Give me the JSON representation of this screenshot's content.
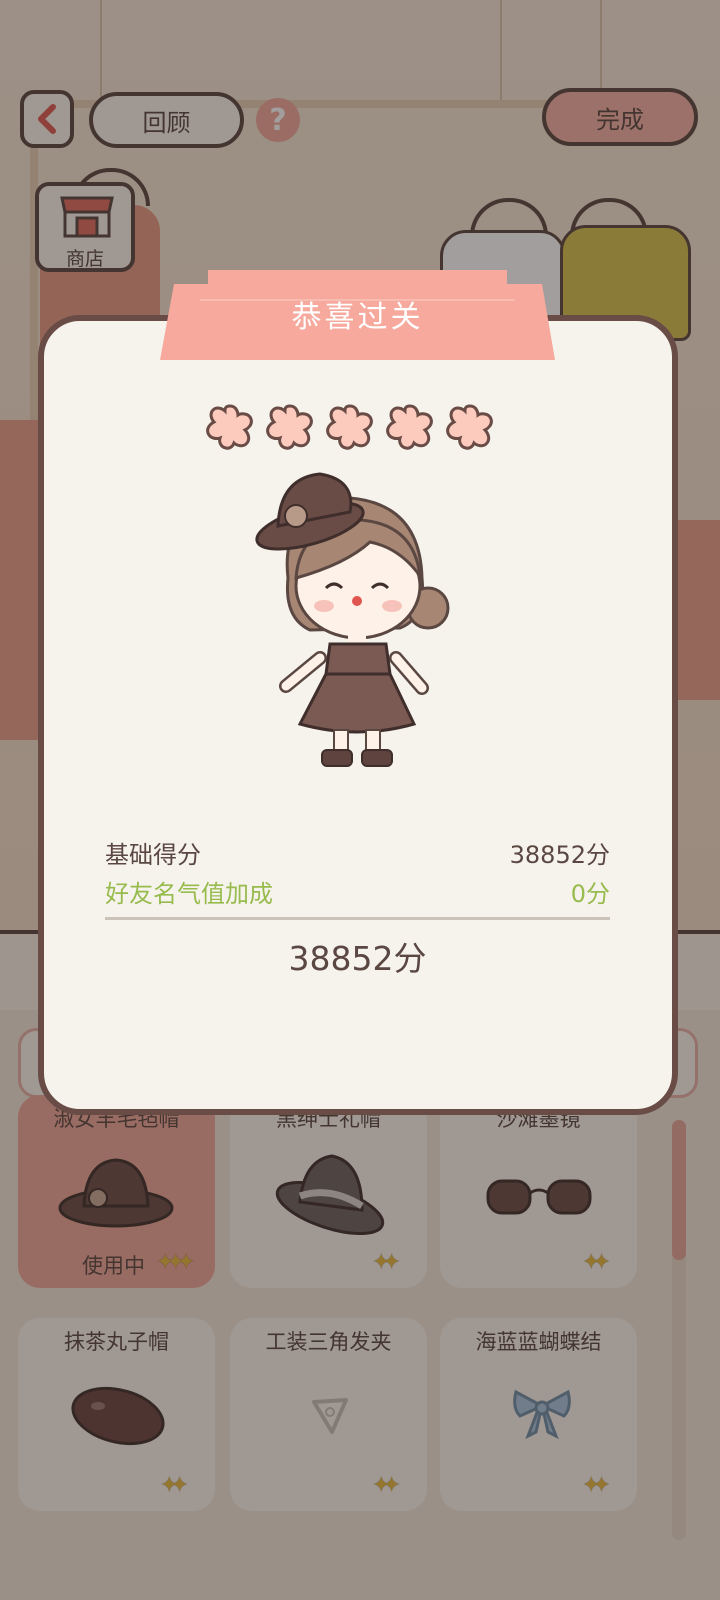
{
  "header": {
    "back_icon": "chevron-left-icon",
    "review_label": "回顾",
    "help_icon": "question-mark-icon",
    "done_label": "完成"
  },
  "shop": {
    "label": "商店",
    "icon": "shop-icon"
  },
  "items": [
    {
      "name": "淑女羊毛毡帽",
      "status": "使用中",
      "icon": "felt-hat-icon",
      "selected": true
    },
    {
      "name": "黑绅士礼帽",
      "icon": "gentleman-top-hat-icon",
      "selected": false
    },
    {
      "name": "沙滩墨镜",
      "icon": "sunglasses-icon",
      "selected": false
    },
    {
      "name": "抹茶丸子帽",
      "icon": "beret-icon",
      "selected": false
    },
    {
      "name": "工装三角发夹",
      "icon": "hair-clip-icon",
      "selected": false
    },
    {
      "name": "海蓝蓝蝴蝶结",
      "icon": "blue-bow-icon",
      "selected": false
    }
  ],
  "dialog": {
    "title": "恭喜过关",
    "stars": 5,
    "star_icon": "flower-star-icon",
    "character": "dressed-character-illustration",
    "base_score_label": "基础得分",
    "base_score_value": "38852分",
    "bonus_label": "好友名气值加成",
    "bonus_value": "0分",
    "total": "38852分"
  },
  "colors": {
    "outline": "#5b4742",
    "ribbon": "#f6a99c",
    "star_fill": "#fdcbbd",
    "bonus_green": "#98bb4e",
    "selected_card": "#f0a899",
    "done_button": "#f4b1a5"
  }
}
